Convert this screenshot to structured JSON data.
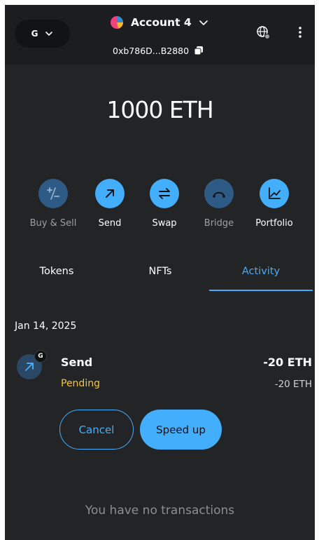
{
  "header": {
    "network_initial": "G",
    "account_name": "Account 4",
    "account_address": "0xb786D...B2880"
  },
  "balance": {
    "text": "1000 ETH"
  },
  "actions": [
    {
      "label": "Buy & Sell",
      "icon": "plus-minus-icon",
      "enabled": false
    },
    {
      "label": "Send",
      "icon": "arrow-up-right-icon",
      "enabled": true
    },
    {
      "label": "Swap",
      "icon": "swap-arrows-icon",
      "enabled": true
    },
    {
      "label": "Bridge",
      "icon": "bridge-icon",
      "enabled": false
    },
    {
      "label": "Portfolio",
      "icon": "chart-line-icon",
      "enabled": true
    }
  ],
  "tabs": [
    {
      "label": "Tokens",
      "active": false
    },
    {
      "label": "NFTs",
      "active": false
    },
    {
      "label": "Activity",
      "active": true
    }
  ],
  "activity": {
    "date": "Jan 14, 2025",
    "transaction": {
      "badge": "G",
      "title": "Send",
      "status": "Pending",
      "amount": "-20 ETH",
      "amount_secondary": "-20 ETH",
      "cancel_label": "Cancel",
      "speed_up_label": "Speed up"
    },
    "empty_message": "You have no transactions"
  },
  "colors": {
    "accent": "#43aefc",
    "background": "#232426",
    "header": "#1c1d20",
    "pending": "#f3c63f"
  }
}
